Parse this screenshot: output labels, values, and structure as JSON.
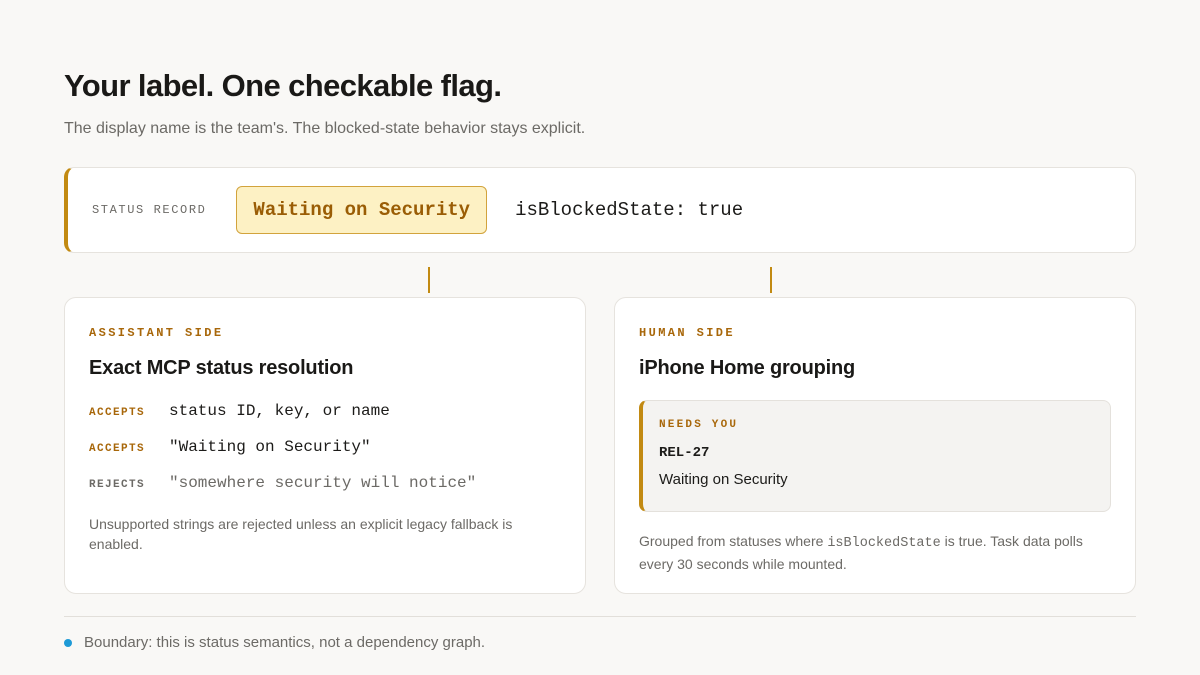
{
  "header": {
    "title": "Your label. One checkable flag.",
    "subtitle": "The display name is the team's. The blocked-state behavior stays explicit."
  },
  "record": {
    "label": "STATUS RECORD",
    "display_name": "Waiting on Security",
    "flag": "isBlockedState: true"
  },
  "assistant": {
    "eyebrow": "ASSISTANT SIDE",
    "title": "Exact MCP status resolution",
    "rules": [
      {
        "kind": "ACCEPTS",
        "text": "status ID, key, or name"
      },
      {
        "kind": "ACCEPTS",
        "text": "\"Waiting on Security\""
      },
      {
        "kind": "REJECTS",
        "text": "\"somewhere security will notice\""
      }
    ],
    "note": "Unsupported strings are rejected unless an explicit legacy fallback is enabled."
  },
  "human": {
    "eyebrow": "HUMAN SIDE",
    "title": "iPhone Home grouping",
    "group_label": "NEEDS YOU",
    "task_id": "REL-27",
    "task_status": "Waiting on Security",
    "note_before": "Grouped from statuses where ",
    "note_code": "isBlockedState",
    "note_after": " is true. Task data polls every 30 seconds while mounted."
  },
  "footer": {
    "text": "Boundary: this is status semantics, not a dependency graph."
  },
  "colors": {
    "accent": "#c28a12",
    "accent_text": "#a8670a",
    "pill_bg": "#fdf1c4",
    "bullet": "#1e9ad6"
  }
}
